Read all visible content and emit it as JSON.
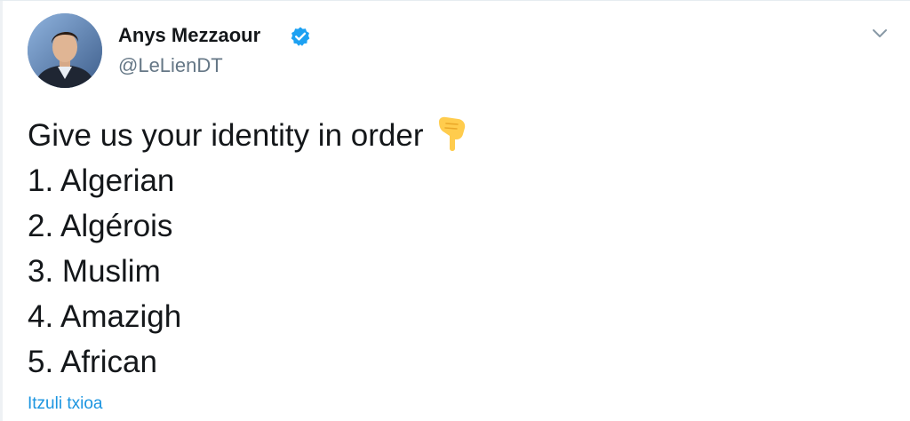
{
  "author": {
    "display_name": "Anys Mezzaour",
    "handle": "@LeLienDT",
    "verified": true
  },
  "tweet": {
    "intro": "Give us your identity in order",
    "intro_emoji": "pointing-down-hand",
    "lines": [
      "1. Algerian",
      "2. Algérois",
      "3. Muslim",
      "4. Amazigh",
      "5. African"
    ]
  },
  "translate_link": "Itzuli txioa",
  "colors": {
    "link": "#1b95e0",
    "verified": "#1da1f2",
    "handle": "#657786",
    "text": "#14171a"
  },
  "icons": {
    "menu": "chevron-down-icon",
    "verified": "verified-badge-icon",
    "emoji": "pointing-down-emoji-icon"
  }
}
